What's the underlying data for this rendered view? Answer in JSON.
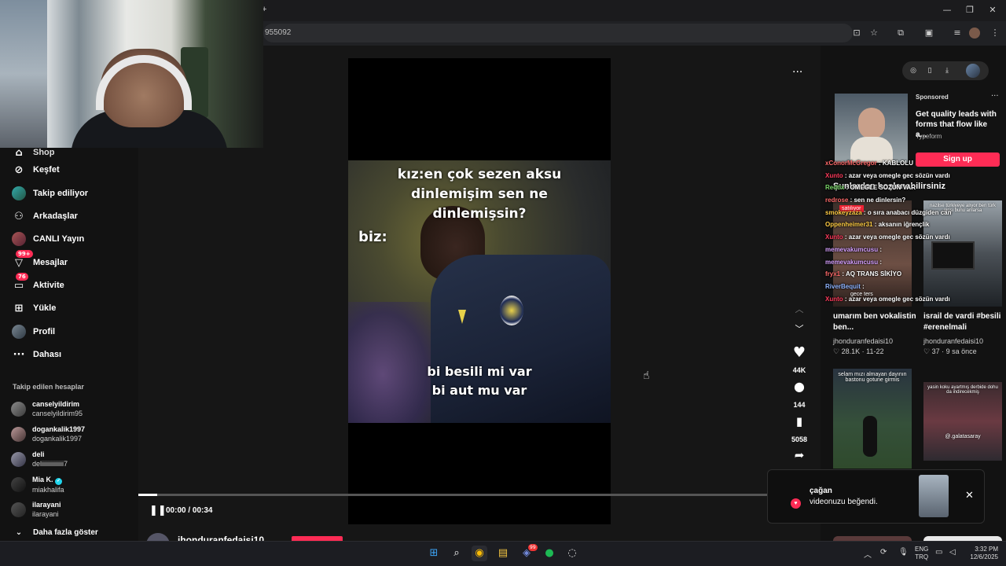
{
  "browser": {
    "url_fragment": "955092",
    "new_tab": "+"
  },
  "sidebar": {
    "partial_item": "Shop",
    "nav": [
      {
        "label": "Keşfet",
        "icon": "compass-icon"
      },
      {
        "label": "Takip ediliyor",
        "icon": "avatar"
      },
      {
        "label": "Arkadaşlar",
        "icon": "friends-icon"
      },
      {
        "label": "CANLI Yayın",
        "icon": "avatar"
      },
      {
        "label": "Mesajlar",
        "icon": "message-icon",
        "badge": "99+"
      },
      {
        "label": "Aktivite",
        "icon": "activity-icon",
        "badge": "76"
      },
      {
        "label": "Yükle",
        "icon": "upload-icon"
      },
      {
        "label": "Profil",
        "icon": "avatar"
      },
      {
        "label": "Dahası",
        "icon": "more-icon"
      }
    ],
    "following_title": "Takip edilen hesaplar",
    "following": [
      {
        "user": "canselyildirim",
        "name": "canselyildirim95"
      },
      {
        "user": "dogankalik1997",
        "name": "dogankalik1997"
      },
      {
        "user": "deli",
        "name": "deliiiiiiiiiiiiii7"
      },
      {
        "user": "Mia K.",
        "name": "miakhalifa",
        "verified": true
      },
      {
        "user": "ilarayani",
        "name": "ilarayani"
      }
    ],
    "show_more": "Daha fazla göster"
  },
  "video": {
    "caption_top": [
      "kız:en çok sezen aksu",
      "dinlemişim sen ne",
      "dinlemişsin?"
    ],
    "caption_biz": "biz:",
    "caption_bottom": [
      "bi besili mi var",
      "bi aut mu var"
    ],
    "time": "00:00 / 00:34",
    "progress": 0.03,
    "author_partial": "jhonduranfedaisi10",
    "likes": "44K",
    "comments": "144",
    "saves": "5058"
  },
  "ad": {
    "label": "Sponsored",
    "text": "Get quality leads with forms that flow like a...",
    "brand": "Typeform",
    "cta": "Sign up"
  },
  "recommend": {
    "heading_overlay": "Şunlardan hoşlanabilirsiniz",
    "cards": [
      {
        "title": "umarım ben vokalistin ben...",
        "user": "jhonduranfedaisi10",
        "likes": "28.1K",
        "date": "11-22"
      },
      {
        "title": "israil de vardi #besili #erenelmali",
        "user": "jhonduranfedaisi10",
        "likes": "37",
        "date": "9 sa önce"
      }
    ],
    "thumb_texts": [
      "satılıyor",
      "nazilse türkiyeye alıyor ben türk girişi bunu anlarsa",
      "gece ters",
      "selam mızı almayan dayının bastonu gotune girmis",
      "yasin koku ayartmış derbide dohu da indirecekmiş",
      "@.galatasaray"
    ]
  },
  "chat": [
    {
      "user": "xConorMcGregor",
      "msg": "KABLOLU",
      "color": "#ff6a6a"
    },
    {
      "user": "Xunto",
      "msg": "azar veya omegle gec sözün vardı",
      "color": "#ff3b5c"
    },
    {
      "user": "Redtix",
      "msg": "OMEGLE SOZUN VAR",
      "color": "#7bd96a"
    },
    {
      "user": "redrose",
      "msg": "sen ne dinlersin?",
      "color": "#ff6a6a"
    },
    {
      "user": "smokeyzaza",
      "msg": "o sıra anabacı düzgiden can",
      "color": "#ffcc44"
    },
    {
      "user": "Oppenheimer31",
      "msg": "aksanın iğrençlik",
      "color": "#ffcc44"
    },
    {
      "user": "Xunto",
      "msg": "azar veya omegle gec sözün vardı",
      "color": "#ff3b5c"
    },
    {
      "user": "memevakumcusu",
      "msg": "",
      "color": "#d6a0ff"
    },
    {
      "user": "memevakumcusu",
      "msg": "",
      "color": "#d6a0ff"
    },
    {
      "user": "fryx1",
      "msg": "AQ TRANS SİKİYO",
      "color": "#ff6a6a"
    },
    {
      "user": "RiverBequit",
      "msg": "",
      "color": "#8fb4ff"
    },
    {
      "user": "Xunto",
      "msg": "azar veya omegle gec sözün vardı",
      "color": "#ff3b5c"
    }
  ],
  "toast": {
    "user": "çağan",
    "msg": "videonuzu beğendi."
  },
  "taskbar": {
    "lang1": "ENG",
    "lang2": "TRQ",
    "time": "3:32 PM",
    "date": "12/6/2025",
    "discord_badge": "99"
  }
}
